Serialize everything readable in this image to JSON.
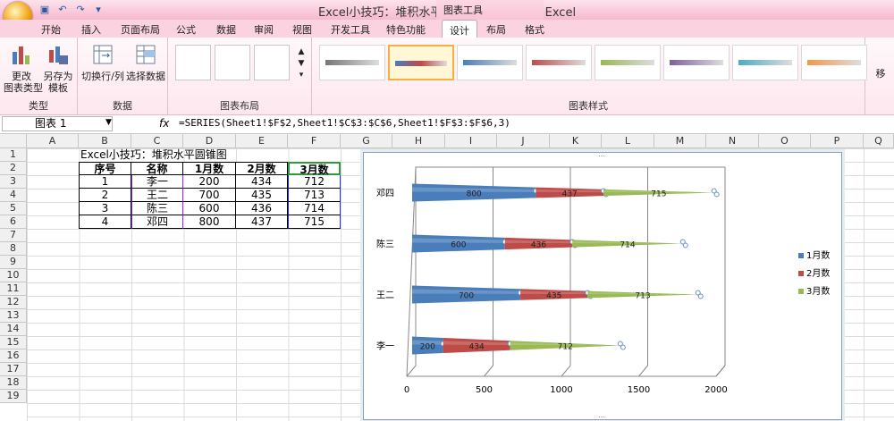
{
  "window": {
    "title": "Excel小技巧：堆积水平圆锥图 - Microsoft Excel",
    "context_tools": "图表工具"
  },
  "tabs": [
    {
      "label": "开始"
    },
    {
      "label": "插入"
    },
    {
      "label": "页面布局"
    },
    {
      "label": "公式"
    },
    {
      "label": "数据"
    },
    {
      "label": "审阅"
    },
    {
      "label": "视图"
    },
    {
      "label": "开发工具"
    },
    {
      "label": "特色功能"
    },
    {
      "label": "设计"
    },
    {
      "label": "布局"
    },
    {
      "label": "格式"
    }
  ],
  "ribbon": {
    "type_group": {
      "label": "类型",
      "change_type": "更改\n图表类型",
      "save_template": "另存为\n模板"
    },
    "data_group": {
      "label": "数据",
      "switch_row_col": "切换行/列",
      "select_data": "选择数据"
    },
    "layout_group": {
      "label": "图表布局"
    },
    "styles_group": {
      "label": "图表样式"
    },
    "move_partial": "移"
  },
  "formula_bar": {
    "name_box": "图表 1",
    "fx": "fx",
    "formula": "=SERIES(Sheet1!$F$2,Sheet1!$C$3:$C$6,Sheet1!$F$3:$F$6,3)"
  },
  "columns": [
    "A",
    "B",
    "C",
    "D",
    "E",
    "F",
    "G",
    "H",
    "I",
    "J",
    "K",
    "L",
    "M",
    "N",
    "O",
    "P",
    "Q"
  ],
  "rows": [
    "1",
    "2",
    "3",
    "4",
    "5",
    "6",
    "7",
    "8",
    "9",
    "10",
    "11",
    "12",
    "13",
    "14",
    "15",
    "16",
    "17",
    "18",
    "19"
  ],
  "sheet": {
    "caption": "Excel小技巧：堆积水平圆锥图",
    "headers": [
      "序号",
      "名称",
      "1月数",
      "2月数",
      "3月数"
    ],
    "rows": [
      [
        "1",
        "李一",
        "200",
        "434",
        "712"
      ],
      [
        "2",
        "王二",
        "700",
        "435",
        "713"
      ],
      [
        "3",
        "陈三",
        "600",
        "436",
        "714"
      ],
      [
        "4",
        "邓四",
        "800",
        "437",
        "715"
      ]
    ]
  },
  "colors": {
    "series1": "#4a7ebb",
    "series2": "#be4b48",
    "series3": "#98b954"
  },
  "chart_data": {
    "type": "bar",
    "orientation": "horizontal",
    "stacked": true,
    "shape": "cone",
    "categories": [
      "李一",
      "王二",
      "陈三",
      "邓四"
    ],
    "series": [
      {
        "name": "1月数",
        "values": [
          200,
          700,
          600,
          800
        ]
      },
      {
        "name": "2月数",
        "values": [
          434,
          435,
          436,
          437
        ]
      },
      {
        "name": "3月数",
        "values": [
          712,
          713,
          714,
          715
        ]
      }
    ],
    "xlim": [
      0,
      2000
    ],
    "xticks": [
      "0",
      "500",
      "1000",
      "1500",
      "2000"
    ],
    "legend": "right",
    "grid": true
  }
}
